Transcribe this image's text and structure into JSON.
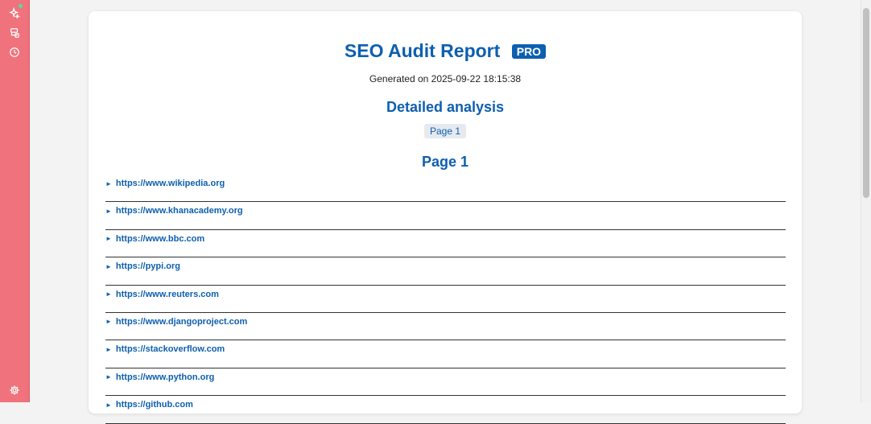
{
  "sidebar": {
    "icons": [
      "sparkle-icon",
      "server-icon",
      "history-icon",
      "settings-icon"
    ],
    "accent": "#f0727c"
  },
  "report": {
    "title": "SEO Audit Report",
    "badge": "PRO",
    "generated": "Generated on 2025-09-22 18:15:38",
    "section_title": "Detailed analysis",
    "page_chip": "Page 1",
    "page_heading": "Page 1",
    "accent": "#0d5fb0",
    "urls": [
      "https://www.wikipedia.org",
      "https://www.khanacademy.org",
      "https://www.bbc.com",
      "https://pypi.org",
      "https://www.reuters.com",
      "https://www.djangoproject.com",
      "https://stackoverflow.com",
      "https://www.python.org",
      "https://github.com"
    ]
  }
}
